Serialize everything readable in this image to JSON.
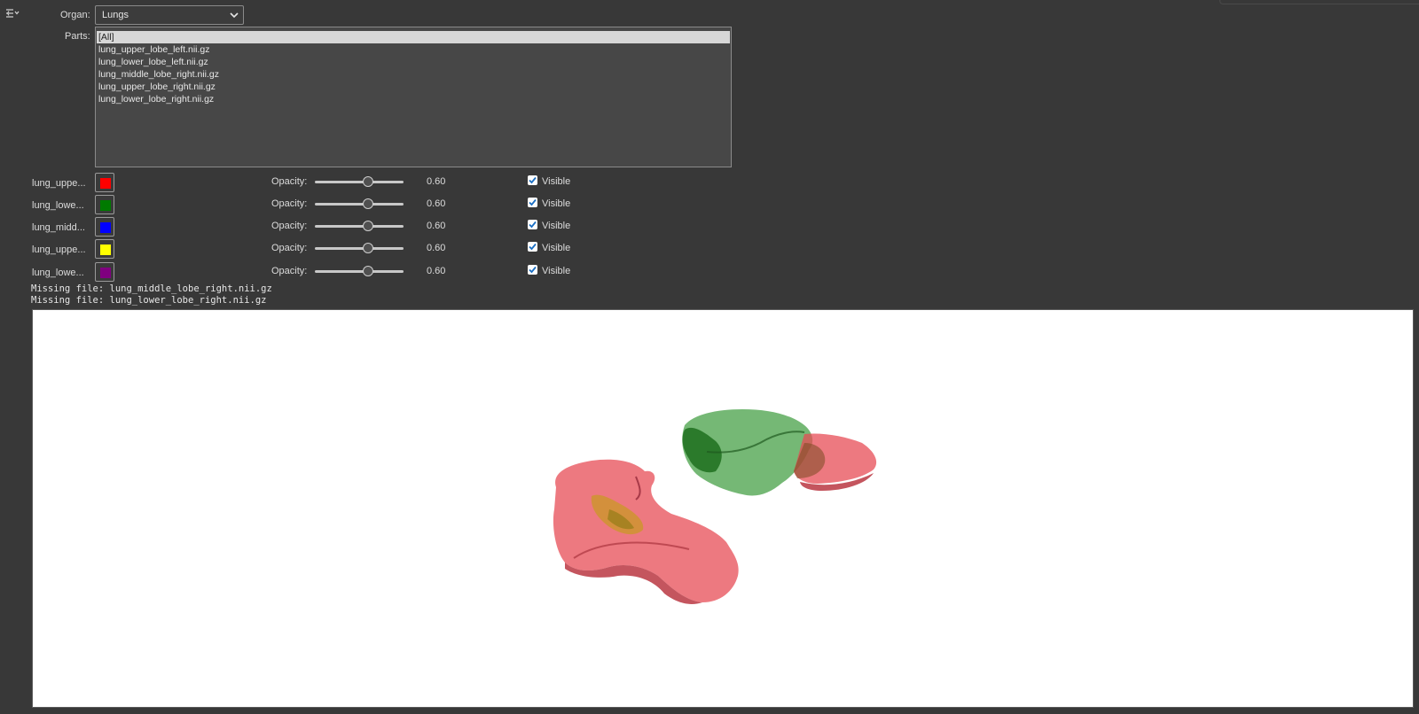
{
  "toolbar": {
    "icon": "collapse-panel-icon"
  },
  "organ": {
    "label": "Organ:",
    "value": "Lungs"
  },
  "parts": {
    "label": "Parts:",
    "items": [
      "[All]",
      "lung_upper_lobe_left.nii.gz",
      "lung_lower_lobe_left.nii.gz",
      "lung_middle_lobe_right.nii.gz",
      "lung_upper_lobe_right.nii.gz",
      "lung_lower_lobe_right.nii.gz"
    ],
    "selected_index": 0
  },
  "rows": [
    {
      "name": "lung_uppe...",
      "color": "#ff0000",
      "opacity_label": "Opacity:",
      "opacity": 0.6,
      "opacity_text": "0.60",
      "visible": true,
      "visible_label": "Visible"
    },
    {
      "name": "lung_lowe...",
      "color": "#007a00",
      "opacity_label": "Opacity:",
      "opacity": 0.6,
      "opacity_text": "0.60",
      "visible": true,
      "visible_label": "Visible"
    },
    {
      "name": "lung_midd...",
      "color": "#0000ff",
      "opacity_label": "Opacity:",
      "opacity": 0.6,
      "opacity_text": "0.60",
      "visible": true,
      "visible_label": "Visible"
    },
    {
      "name": "lung_uppe...",
      "color": "#ffff00",
      "opacity_label": "Opacity:",
      "opacity": 0.6,
      "opacity_text": "0.60",
      "visible": true,
      "visible_label": "Visible"
    },
    {
      "name": "lung_lowe...",
      "color": "#800080",
      "opacity_label": "Opacity:",
      "opacity": 0.6,
      "opacity_text": "0.60",
      "visible": true,
      "visible_label": "Visible"
    }
  ],
  "messages": [
    "Missing file: lung_middle_lobe_right.nii.gz",
    "Missing file: lung_lower_lobe_right.nii.gz"
  ],
  "viewport": {
    "background": "#ffffff",
    "surfaces": [
      {
        "part": "lung_upper_lobe_left",
        "color": "#e8404a"
      },
      {
        "part": "lung_lower_lobe_left",
        "color": "#2f8a2f"
      },
      {
        "part": "lung_upper_lobe_right",
        "color": "#c9a020"
      }
    ]
  }
}
